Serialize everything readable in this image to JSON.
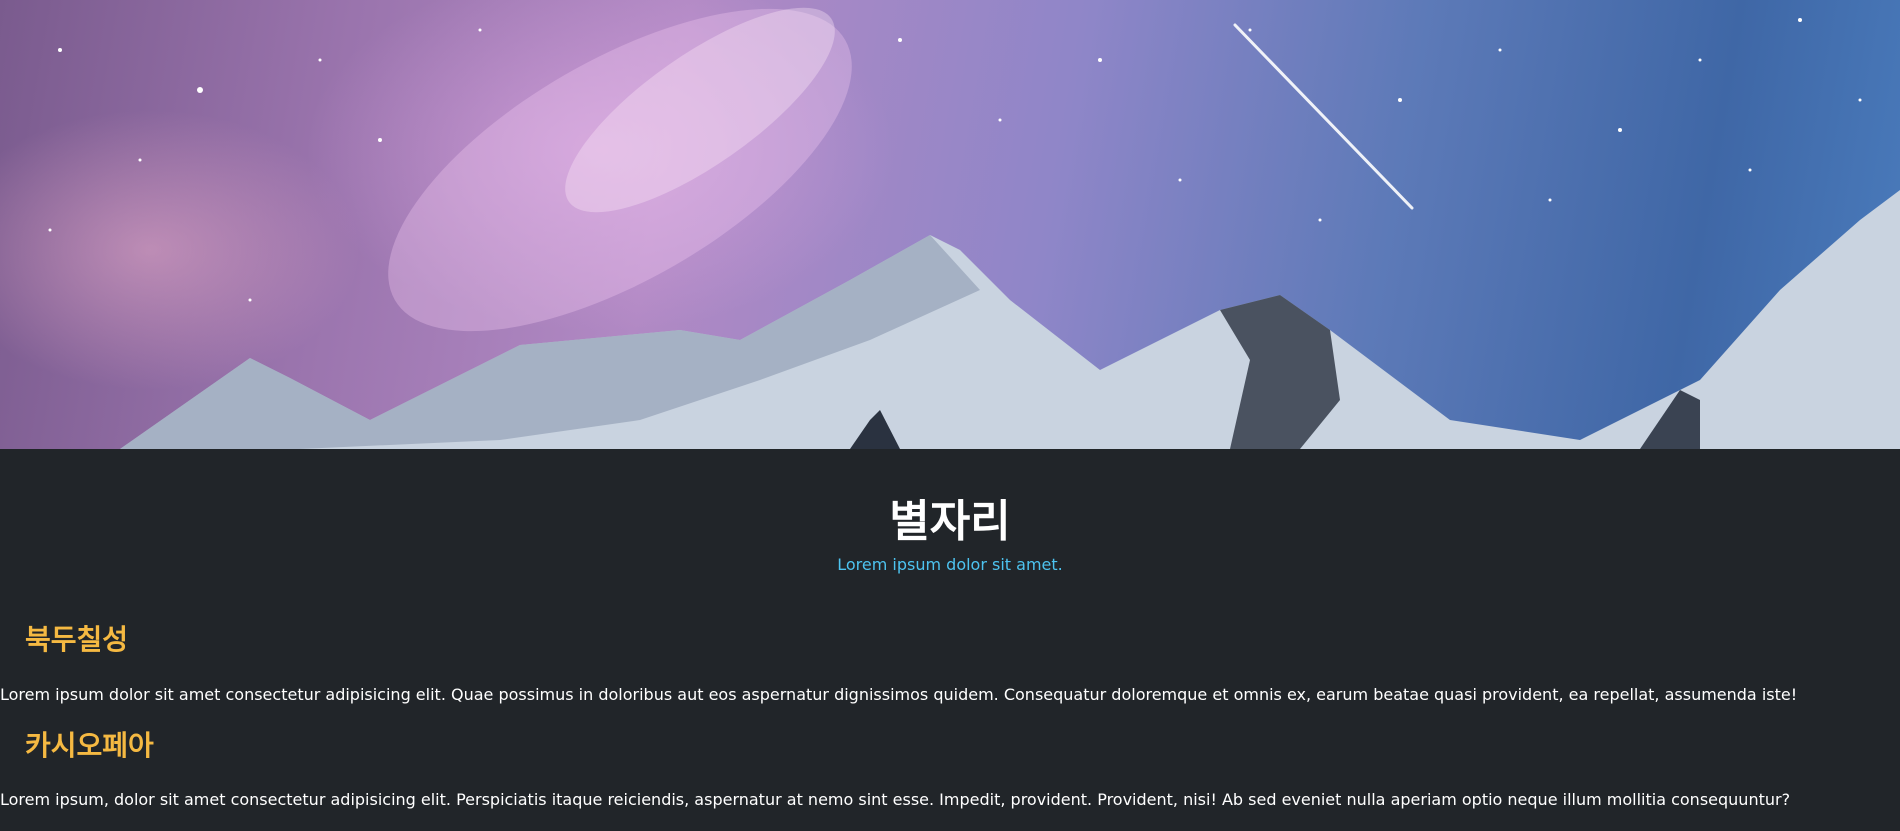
{
  "hero": {
    "icon": "starry-mountain-image"
  },
  "header": {
    "title": "별자리",
    "subtitle": "Lorem ipsum dolor sit amet."
  },
  "sections": [
    {
      "heading": "북두칠성",
      "text": "Lorem ipsum dolor sit amet consectetur adipisicing elit. Quae possimus in doloribus aut eos aspernatur dignissimos quidem. Consequatur doloremque et omnis ex, earum beatae quasi provident, ea repellat, assumenda iste!"
    },
    {
      "heading": "카시오페아",
      "text": "Lorem ipsum, dolor sit amet consectetur adipisicing elit. Perspiciatis itaque reiciendis, aspernatur at nemo sint esse. Impedit, provident. Provident, nisi! Ab sed eveniet nulla aperiam optio neque illum mollitia consequuntur?"
    }
  ],
  "colors": {
    "background": "#212529",
    "title": "#ffffff",
    "subtitle": "#4dc3ef",
    "heading": "#f5b942",
    "text": "#ffffff"
  }
}
